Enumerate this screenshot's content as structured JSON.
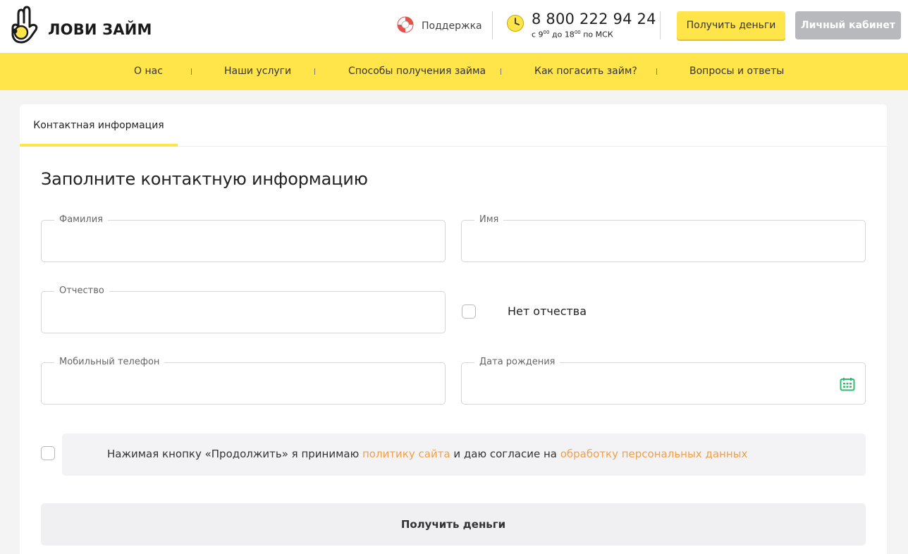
{
  "brand": {
    "name": "ЛОВИ ЗАЙМ",
    "accent": "#ffe44a",
    "link_color": "#f0a04a"
  },
  "header": {
    "support_label": "Поддержка",
    "phone": "8 800 222 94 24",
    "hours": {
      "prefix": "с ",
      "from": "9",
      "from_sup": "00",
      "mid": " до ",
      "to": "18",
      "to_sup": "00",
      "suffix": " по МСК"
    },
    "get_money_label": "Получить деньги",
    "cabinet_label": "Личный кабинет"
  },
  "nav": {
    "items": [
      {
        "label": "О нас"
      },
      {
        "label": "Наши услуги"
      },
      {
        "label": "Способы получения займа"
      },
      {
        "label": "Как погасить займ?"
      },
      {
        "label": "Вопросы и ответы"
      }
    ]
  },
  "tabs": [
    {
      "label": "Контактная информация",
      "active": true
    }
  ],
  "form": {
    "title": "Заполните контактную информацию",
    "fields": {
      "surname": {
        "label": "Фамилия",
        "value": ""
      },
      "name": {
        "label": "Имя",
        "value": ""
      },
      "patronymic": {
        "label": "Отчество",
        "value": ""
      },
      "no_patronymic_label": "Нет отчества",
      "phone": {
        "label": "Мобильный телефон",
        "value": ""
      },
      "birthdate": {
        "label": "Дата рождения",
        "value": ""
      }
    },
    "consent": {
      "text_1": "Нажимая кнопку «Продолжить» я принимаю ",
      "link_1": "политику сайта",
      "text_2": " и даю согласие на ",
      "link_2": "обработку персональных данных",
      "checked": false
    },
    "submit_label": "Получить деньги"
  },
  "icons": [
    "hand-logo-icon",
    "lifebuoy-icon",
    "clock-icon",
    "calendar-icon"
  ]
}
